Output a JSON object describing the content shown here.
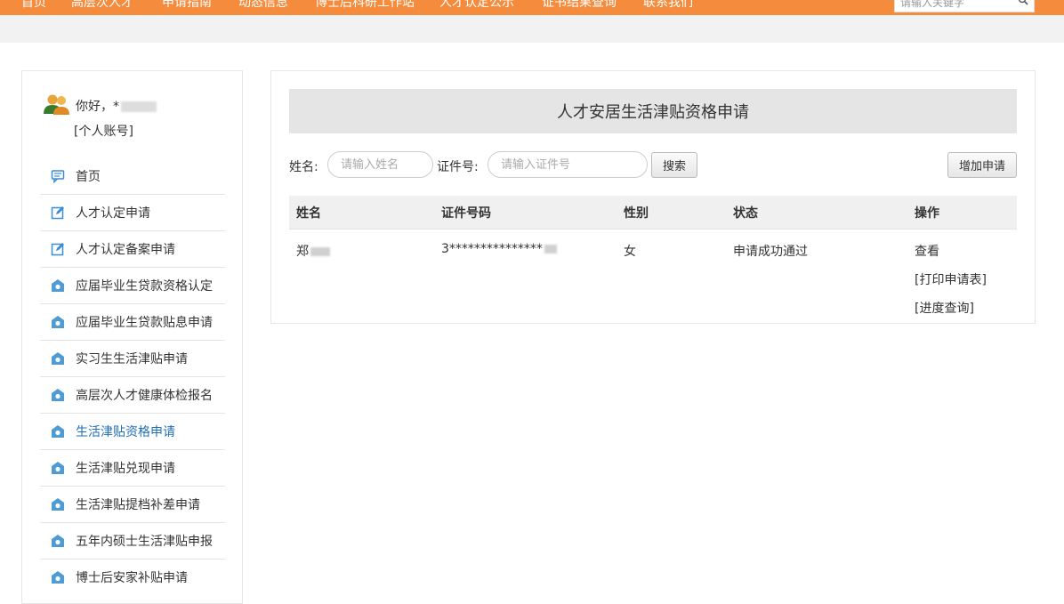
{
  "nav": {
    "items": [
      "首页",
      "高层次人才",
      "申请指南",
      "动态信息",
      "博士后科研工作站",
      "人才认定公示",
      "证书结果查询",
      "联系我们"
    ],
    "search_placeholder": "请输入关键字",
    "accent_color": "#f58b3c"
  },
  "sidebar": {
    "greeting": "你好，",
    "greeting_name_partial": "*",
    "account_label": "[个人账号]",
    "active_color": "#1f6fb8",
    "items": [
      {
        "label": "首页",
        "icon": "chat-icon"
      },
      {
        "label": "人才认定申请",
        "icon": "edit-icon"
      },
      {
        "label": "人才认定备案申请",
        "icon": "edit-icon"
      },
      {
        "label": "应届毕业生贷款资格认定",
        "icon": "home-icon"
      },
      {
        "label": "应届毕业生贷款贴息申请",
        "icon": "home-icon"
      },
      {
        "label": "实习生生活津贴申请",
        "icon": "home-icon"
      },
      {
        "label": "高层次人才健康体检报名",
        "icon": "home-icon"
      },
      {
        "label": "生活津贴资格申请",
        "icon": "home-icon",
        "active": true
      },
      {
        "label": "生活津贴兑现申请",
        "icon": "home-icon"
      },
      {
        "label": "生活津贴提档补差申请",
        "icon": "home-icon"
      },
      {
        "label": "五年内硕士生活津贴申报",
        "icon": "home-icon"
      },
      {
        "label": "博士后安家补贴申请",
        "icon": "home-icon"
      }
    ]
  },
  "main": {
    "title": "人才安居生活津贴资格申请",
    "search": {
      "name_label": "姓名:",
      "name_placeholder": "请输入姓名",
      "id_label": "证件号:",
      "id_placeholder": "请输入证件号",
      "search_button": "搜索",
      "add_button": "增加申请"
    },
    "table": {
      "headers": [
        "姓名",
        "证件号码",
        "性别",
        "状态",
        "操作"
      ],
      "rows": [
        {
          "name": "郑",
          "id_number": "3***************",
          "gender": "女",
          "status": "申请成功通过",
          "actions": [
            "查看",
            "[打印申请表]",
            "[进度查询]"
          ]
        }
      ]
    }
  }
}
